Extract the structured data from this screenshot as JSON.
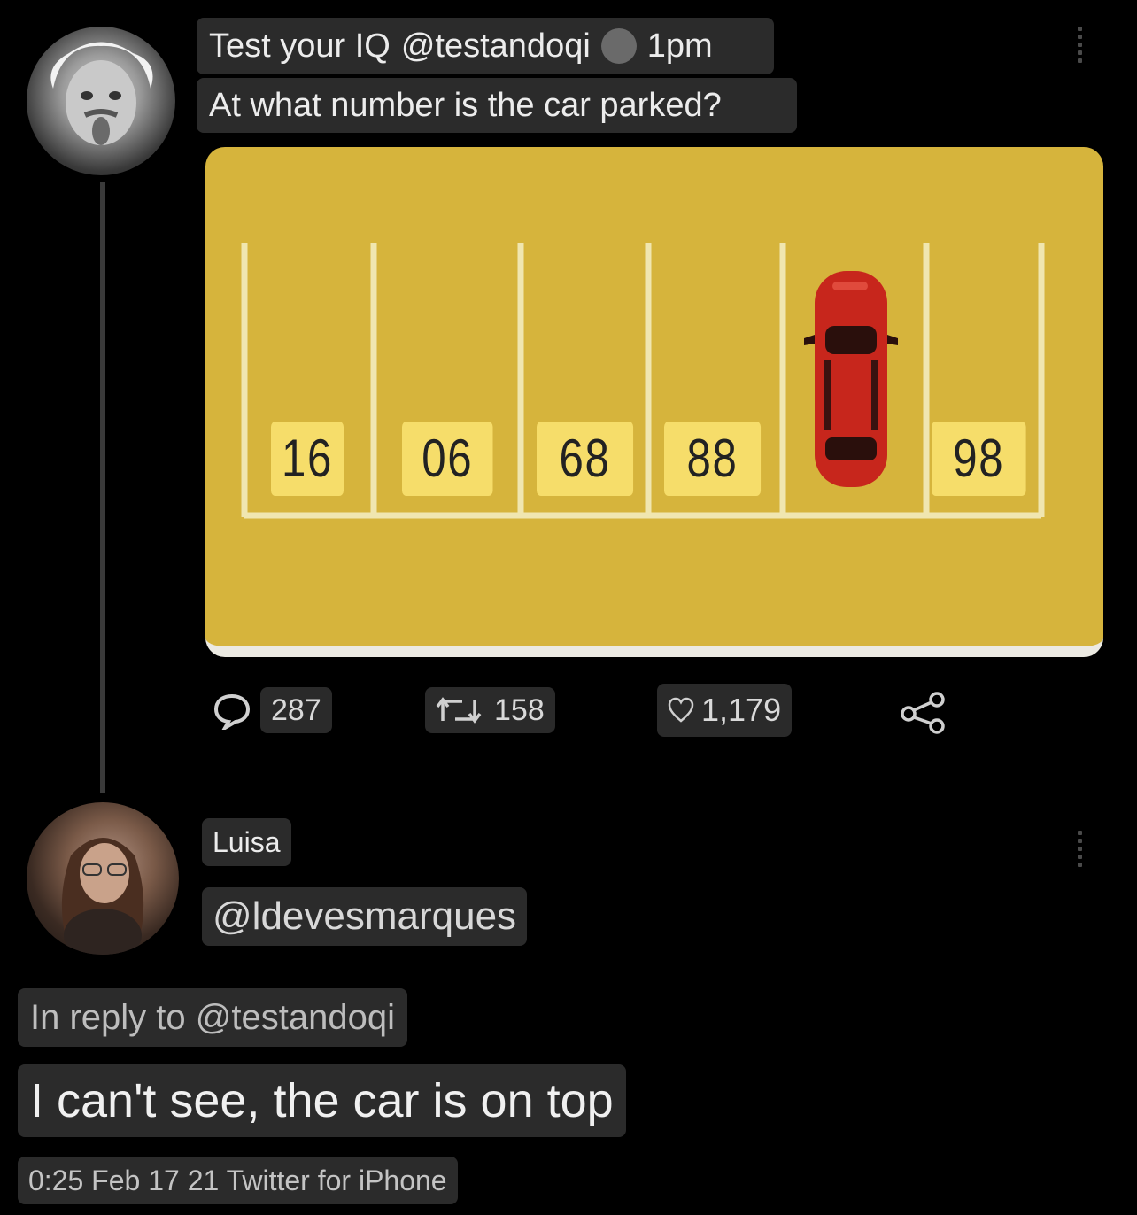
{
  "tweet": {
    "display_name": "Test your IQ",
    "handle": "@testandoqi",
    "time": "1pm",
    "text": "At what number is the car parked?",
    "image": {
      "slot_numbers": [
        "16",
        "06",
        "68",
        "88",
        "98"
      ],
      "background_color": "#d6b43c",
      "car_color": "#c7261c"
    },
    "actions": {
      "replies": "287",
      "retweets": "158",
      "likes": "1,179"
    }
  },
  "reply": {
    "display_name": "Luisa",
    "handle": "@ldevesmarques",
    "in_reply_to": "In reply to @testandoqi",
    "text": "I can't see, the car is on top",
    "meta": "0:25 Feb 17 21 Twitter for iPhone"
  },
  "icons": {
    "reply": "speech-bubble-icon",
    "retweet": "retweet-icon",
    "like": "heart-icon",
    "share": "share-icon",
    "more": "more-vertical-icon"
  }
}
